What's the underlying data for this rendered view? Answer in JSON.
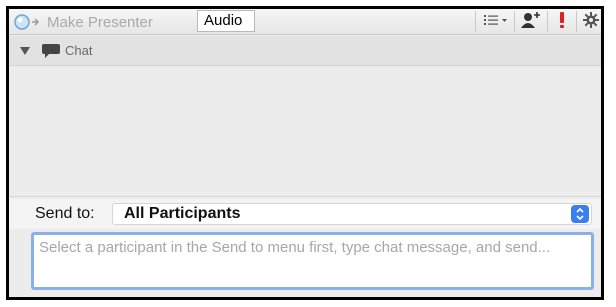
{
  "toolbar": {
    "make_presenter_label": "Make Presenter",
    "audio_label": "Audio",
    "icons": [
      "presenter-icon",
      "list-menu-icon",
      "add-participant-icon",
      "alert-icon",
      "gear-icon"
    ],
    "colors": {
      "alert": "#e02020",
      "presenter_ball": "#6aa6d8"
    }
  },
  "chat": {
    "header_title": "Chat",
    "messages": []
  },
  "send_to": {
    "label": "Send to:",
    "selected": "All Participants",
    "stepper_color": "#3a7ef0"
  },
  "message_input": {
    "placeholder": "Select a participant in the Send to menu first, type chat message, and send...",
    "value": "",
    "focus_ring_color": "#8ab0ec"
  }
}
